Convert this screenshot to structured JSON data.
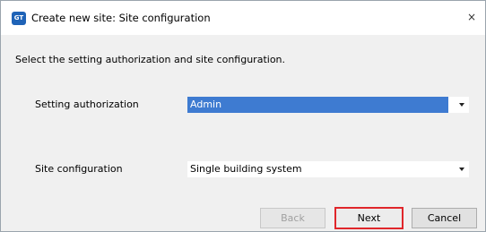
{
  "window": {
    "app_icon_text": "GT",
    "title": "Create new site: Site configuration",
    "close_glyph": "×"
  },
  "instruction": "Select the setting authorization and site configuration.",
  "fields": {
    "setting_authorization": {
      "label": "Setting authorization",
      "value": "Admin"
    },
    "site_configuration": {
      "label": "Site configuration",
      "value": "Single building system"
    }
  },
  "buttons": {
    "back_label": "Back",
    "next_label": "Next",
    "cancel_label": "Cancel"
  },
  "colors": {
    "selection": "#3e7bd1",
    "highlight_border": "#e0262b",
    "icon": "#1f63b7"
  }
}
